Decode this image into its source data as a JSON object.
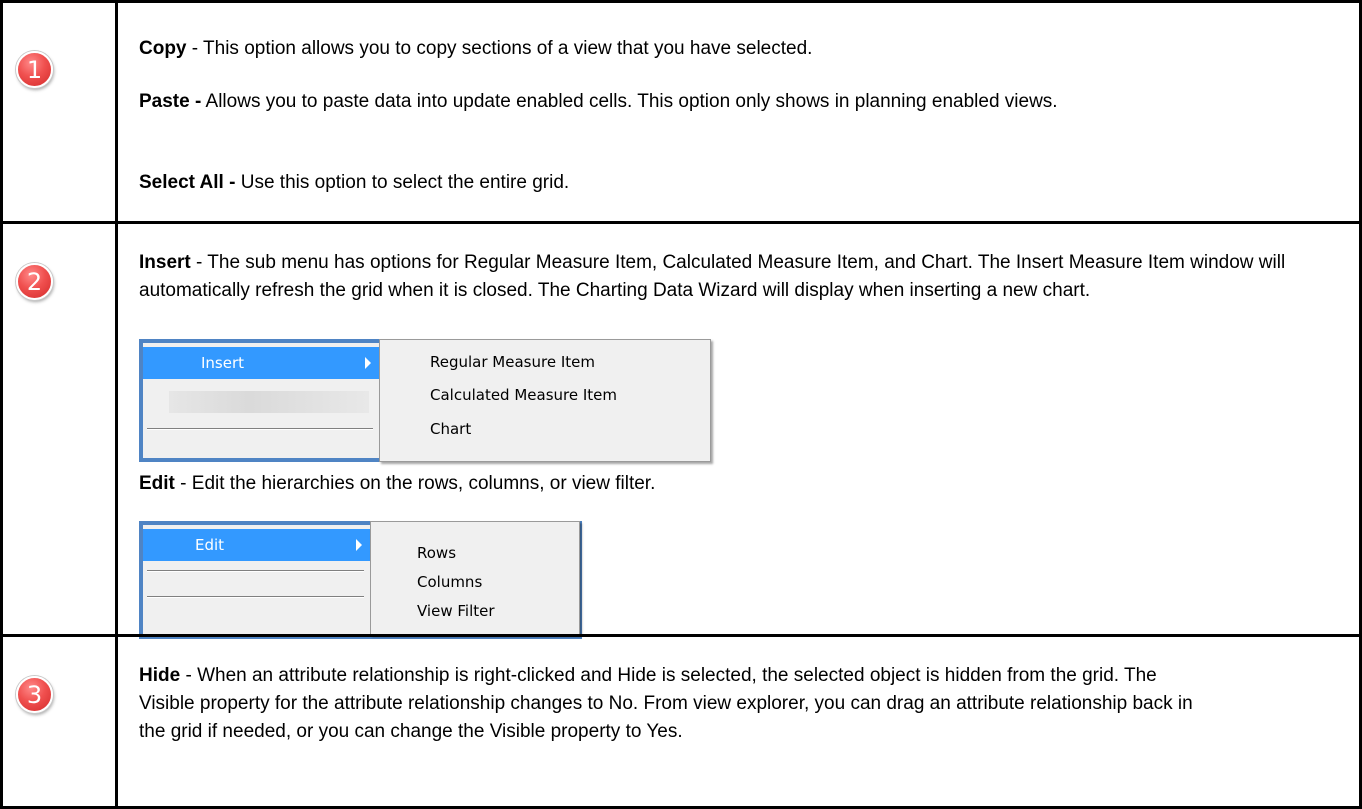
{
  "rows": [
    {
      "number": "1",
      "paragraphs": [
        {
          "term": "Copy",
          "text": " - This option allows you to copy sections of a view that you have selected."
        },
        {
          "term": "Paste -",
          "text": " Allows you to paste data into update enabled cells. This option only shows in planning enabled views."
        },
        {
          "term": "Select All -",
          "text": " Use this option to select the entire grid."
        }
      ]
    },
    {
      "number": "2",
      "paragraphs": [
        {
          "term": "Insert",
          "text": " - The sub menu has options for Regular Measure Item, Calculated Measure Item, and Chart. The Insert Measure Item window will automatically refresh the grid when it is closed. The Charting Data Wizard will display when inserting a new chart."
        },
        {
          "term": "Edit",
          "text": " - Edit the hierarchies on the rows, columns, or view filter."
        }
      ],
      "insert_menu": {
        "selected": "Insert",
        "items": [
          "Regular Measure Item",
          "Calculated Measure Item",
          "Chart"
        ]
      },
      "edit_menu": {
        "selected": "Edit",
        "items": [
          "Rows",
          "Columns",
          "View Filter"
        ]
      }
    },
    {
      "number": "3",
      "paragraphs": [
        {
          "term": "Hide",
          "text": " - When an attribute relationship is right-clicked and Hide is selected, the selected object is hidden from the grid. The Visible property for the attribute relationship changes to No. From view explorer, you can drag an attribute relationship back in the grid if needed, or you can change the Visible property to Yes."
        }
      ]
    }
  ],
  "colors": {
    "badge": "#e8413f",
    "menu_highlight": "#3399ff",
    "frame": "#4f84c4"
  }
}
